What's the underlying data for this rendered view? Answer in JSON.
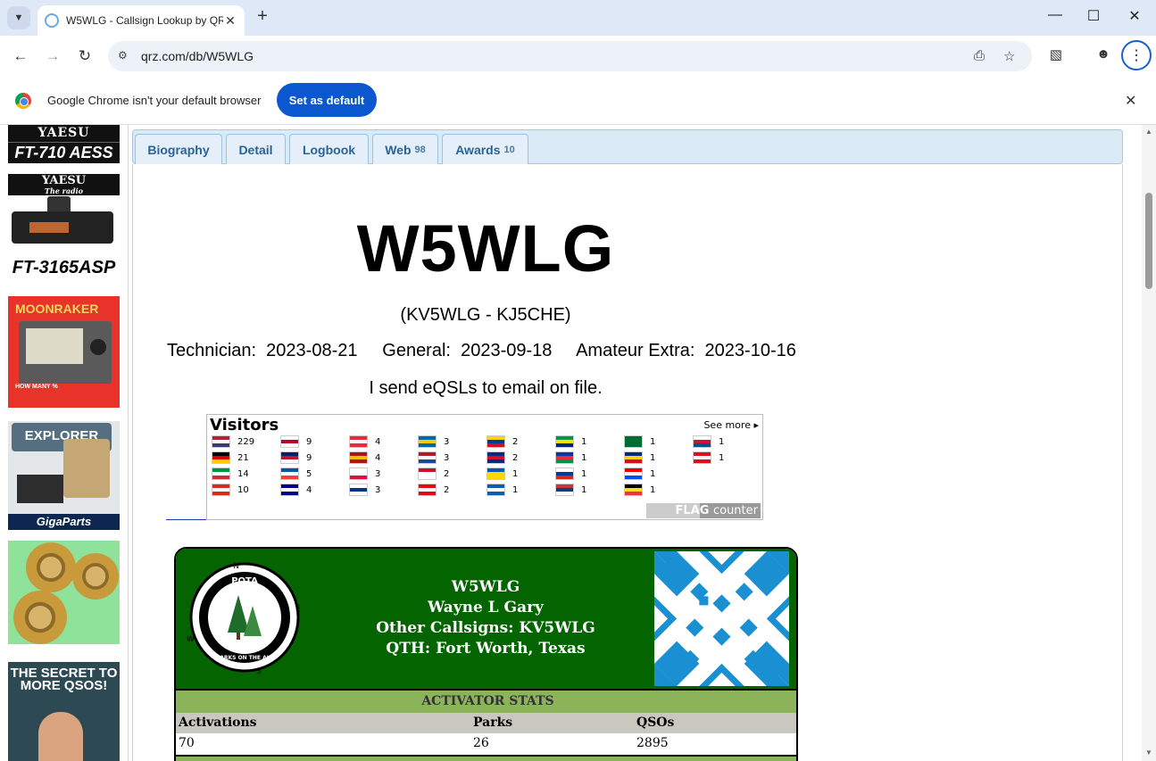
{
  "browser": {
    "tab_title": "W5WLG - Callsign Lookup by QRZ",
    "url": "qrz.com/db/W5WLG",
    "infobar_text": "Google Chrome isn't your default browser",
    "set_default_label": "Set as default"
  },
  "ads": {
    "ad1_brand": "YAESU",
    "ad1_model": "FT-710 AESS",
    "ad2_brand": "YAESU",
    "ad2_tagline": "The radio",
    "ad2_model": "FT-3165ASP",
    "ad3_brand": "MOONRAKER",
    "ad3_cta": "HOW MANY %",
    "ad4_top": "EXPLORER",
    "ad4_bottom": "GigaParts",
    "ad6_text": "THE SECRET TO MORE QSOS!"
  },
  "tabs": [
    {
      "label": "Biography",
      "count": ""
    },
    {
      "label": "Detail",
      "count": ""
    },
    {
      "label": "Logbook",
      "count": ""
    },
    {
      "label": "Web",
      "count": "98"
    },
    {
      "label": "Awards",
      "count": "10"
    }
  ],
  "profile": {
    "callsign": "W5WLG",
    "aliases": "(KV5WLG - KJ5CHE)",
    "licenses": "Technician:  2023-08-21     General:  2023-09-18     Amateur Extra:  2023-10-16",
    "eqsl_note": "I send eQSLs to email on file."
  },
  "flag_counter": {
    "title": "Visitors",
    "see_more": "See more",
    "logo_flag": "FLAG",
    "logo_counter": "counter",
    "entries": [
      {
        "country": "US",
        "count": "229",
        "colors": [
          "#b22234",
          "#fff",
          "#3c3b6e"
        ]
      },
      {
        "country": "DE",
        "count": "21",
        "colors": [
          "#000",
          "#dd0000",
          "#ffce00"
        ]
      },
      {
        "country": "IT",
        "count": "14",
        "colors": [
          "#009246",
          "#fff",
          "#ce2b37"
        ]
      },
      {
        "country": "CA",
        "count": "10",
        "colors": [
          "#d52b1e",
          "#fff",
          "#d52b1e"
        ]
      },
      {
        "country": "JP",
        "count": "9",
        "colors": [
          "#fff",
          "#bc002d",
          "#fff"
        ]
      },
      {
        "country": "GB",
        "count": "9",
        "colors": [
          "#012169",
          "#c8102e",
          "#fff"
        ]
      },
      {
        "country": "FR",
        "count": "5",
        "colors": [
          "#0055a4",
          "#fff",
          "#ef4135"
        ]
      },
      {
        "country": "AU",
        "count": "4",
        "colors": [
          "#00008b",
          "#fff",
          "#00008b"
        ]
      },
      {
        "country": "AT",
        "count": "4",
        "colors": [
          "#ed2939",
          "#fff",
          "#ed2939"
        ]
      },
      {
        "country": "ES",
        "count": "4",
        "colors": [
          "#aa151b",
          "#f1bf00",
          "#aa151b"
        ]
      },
      {
        "country": "PL",
        "count": "3",
        "colors": [
          "#fff",
          "#fff",
          "#dc143c"
        ]
      },
      {
        "country": "FI",
        "count": "3",
        "colors": [
          "#fff",
          "#003580",
          "#fff"
        ]
      },
      {
        "country": "SE",
        "count": "3",
        "colors": [
          "#006aa7",
          "#fecc00",
          "#006aa7"
        ]
      },
      {
        "country": "NL",
        "count": "3",
        "colors": [
          "#ae1c28",
          "#fff",
          "#21468b"
        ]
      },
      {
        "country": "ID",
        "count": "2",
        "colors": [
          "#ce1126",
          "#fff",
          "#fff"
        ]
      },
      {
        "country": "TR",
        "count": "2",
        "colors": [
          "#e30a17",
          "#fff",
          "#e30a17"
        ]
      },
      {
        "country": "CO",
        "count": "2",
        "colors": [
          "#fcd116",
          "#003893",
          "#ce1126"
        ]
      },
      {
        "country": "CR",
        "count": "2",
        "colors": [
          "#002b7f",
          "#ce1126",
          "#002b7f"
        ]
      },
      {
        "country": "UA",
        "count": "1",
        "colors": [
          "#0057b7",
          "#ffd700",
          "#ffd700"
        ]
      },
      {
        "country": "GR",
        "count": "1",
        "colors": [
          "#0d5eaf",
          "#fff",
          "#0d5eaf"
        ]
      },
      {
        "country": "BR",
        "count": "1",
        "colors": [
          "#009c3b",
          "#ffdf00",
          "#002776"
        ]
      },
      {
        "country": "NC",
        "count": "1",
        "colors": [
          "#0035ad",
          "#ed2939",
          "#009543"
        ]
      },
      {
        "country": "RU",
        "count": "1",
        "colors": [
          "#fff",
          "#0039a6",
          "#d52b1e"
        ]
      },
      {
        "country": "RS",
        "count": "1",
        "colors": [
          "#c6363c",
          "#0c4076",
          "#fff"
        ]
      },
      {
        "country": "SA",
        "count": "1",
        "colors": [
          "#006c35",
          "#006c35",
          "#006c35"
        ]
      },
      {
        "country": "RO",
        "count": "1",
        "colors": [
          "#002b7f",
          "#fcd116",
          "#ce1126"
        ]
      },
      {
        "country": "PR",
        "count": "1",
        "colors": [
          "#ed0000",
          "#fff",
          "#0050f0"
        ]
      },
      {
        "country": "BE",
        "count": "1",
        "colors": [
          "#000",
          "#fdda24",
          "#ef3340"
        ]
      },
      {
        "country": "PA",
        "count": "1",
        "colors": [
          "#fff",
          "#d21034",
          "#005293"
        ]
      },
      {
        "country": "PE",
        "count": "1",
        "colors": [
          "#d91023",
          "#fff",
          "#d91023"
        ]
      }
    ]
  },
  "pota": {
    "logo_text": "POTA",
    "logo_sub": "PARKS ON THE AIR",
    "compass": [
      "N",
      "E",
      "S",
      "W"
    ],
    "callsign": "W5WLG",
    "name": "Wayne L Gary",
    "other_callsigns": "Other Callsigns: KV5WLG",
    "qth": "QTH: Fort Worth, Texas",
    "stats_title": "ACTIVATOR STATS",
    "columns": [
      "Activations",
      "Parks",
      "QSOs"
    ],
    "values": [
      "70",
      "26",
      "2895"
    ],
    "colors": {
      "header_green": "#046400",
      "band_green": "#8ab35a",
      "pattern_blue": "#1a8fd1"
    }
  }
}
